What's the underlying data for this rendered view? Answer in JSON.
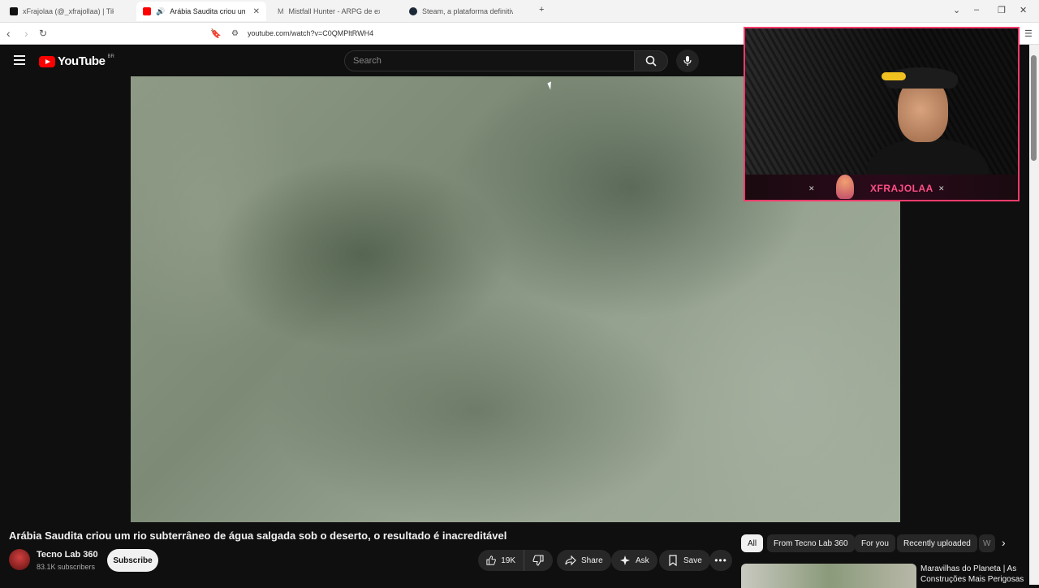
{
  "browser": {
    "tabs": [
      {
        "title": "xFrajolaa (@_xfrajollaa) | TikTok",
        "favicon_color": "#111111"
      },
      {
        "title": "Arábia Saudita criou um rio s",
        "favicon_color": "#ff0000"
      },
      {
        "title": "Mistfall Hunter - ARPG de extração d",
        "favicon_color": "#666666"
      },
      {
        "title": "Steam, a plataforma definitiva de jog",
        "favicon_color": "#1b2838"
      }
    ],
    "url": "youtube.com/watch?v=C0QMPltRWH4"
  },
  "youtube": {
    "logo_text": "YouTube",
    "country_code": "BR",
    "search_placeholder": "Search",
    "video_title": "Arábia Saudita criou um rio subterrâneo de água salgada sob o deserto, o resultado é inacreditável",
    "channel_name": "Tecno Lab 360",
    "subscribers": "83.1K subscribers",
    "subscribe_label": "Subscribe",
    "likes": "19K",
    "share_label": "Share",
    "ask_label": "Ask",
    "save_label": "Save",
    "chips": [
      "All",
      "From Tecno Lab 360",
      "For you",
      "Recently uploaded",
      "W"
    ],
    "recommended_title": "Maravilhas do Planeta | As Construções Mais Perigosas"
  },
  "overlay": {
    "streamer_name": "XFRAJOLAA"
  },
  "colors": {
    "yt_red": "#ff0000",
    "overlay_pink": "#ff3b6b"
  }
}
